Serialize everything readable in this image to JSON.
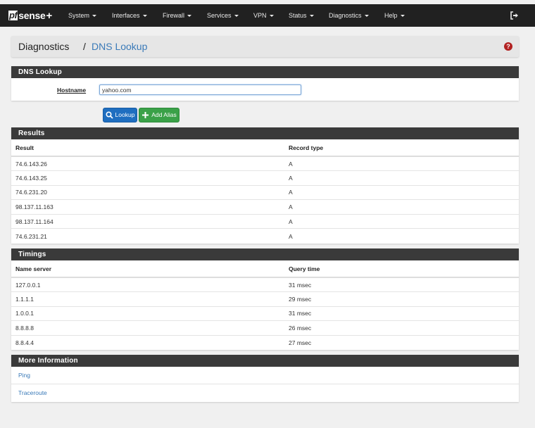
{
  "brand": {
    "logo_pf": "pf",
    "logo_sense": "sense",
    "logo_plus": "+"
  },
  "nav": {
    "items": [
      {
        "label": "System"
      },
      {
        "label": "Interfaces"
      },
      {
        "label": "Firewall"
      },
      {
        "label": "Services"
      },
      {
        "label": "VPN"
      },
      {
        "label": "Status"
      },
      {
        "label": "Diagnostics"
      },
      {
        "label": "Help"
      }
    ],
    "logout_icon": "sign-out-icon"
  },
  "breadcrumb": {
    "section": "Diagnostics",
    "separator": "/",
    "page": "DNS Lookup",
    "help_icon": "question-circle-icon",
    "help_glyph": "?"
  },
  "lookup_panel": {
    "title": "DNS Lookup",
    "hostname_label": "Hostname",
    "hostname_value": "yahoo.com"
  },
  "buttons": {
    "lookup_label": "Lookup",
    "add_alias_label": "Add Alias"
  },
  "results": {
    "title": "Results",
    "headers": {
      "result": "Result",
      "record_type": "Record type"
    },
    "rows": [
      {
        "result": "74.6.143.26",
        "type": "A"
      },
      {
        "result": "74.6.143.25",
        "type": "A"
      },
      {
        "result": "74.6.231.20",
        "type": "A"
      },
      {
        "result": "98.137.11.163",
        "type": "A"
      },
      {
        "result": "98.137.11.164",
        "type": "A"
      },
      {
        "result": "74.6.231.21",
        "type": "A"
      }
    ]
  },
  "timings": {
    "title": "Timings",
    "headers": {
      "server": "Name server",
      "time": "Query time"
    },
    "rows": [
      {
        "server": "127.0.0.1",
        "time": "31 msec"
      },
      {
        "server": "1.1.1.1",
        "time": "29 msec"
      },
      {
        "server": "1.0.0.1",
        "time": "31 msec"
      },
      {
        "server": "8.8.8.8",
        "time": "26 msec"
      },
      {
        "server": "8.8.4.4",
        "time": "27 msec"
      }
    ]
  },
  "more_info": {
    "title": "More Information",
    "links": [
      {
        "label": "Ping"
      },
      {
        "label": "Traceroute"
      }
    ]
  },
  "colors": {
    "navbar": "#212121",
    "panel_header": "#3a3a3a",
    "link": "#3a7ab8",
    "primary_button": "#1f6ec0",
    "success_button": "#3aa148",
    "help": "#b22222"
  }
}
